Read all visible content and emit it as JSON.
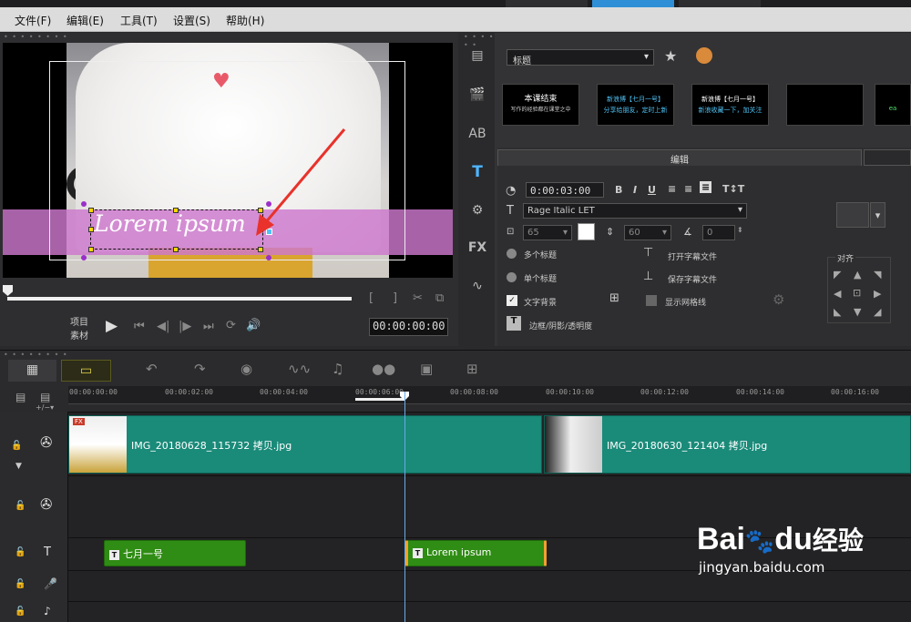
{
  "menu": [
    "文件(F)",
    "编辑(E)",
    "工具(T)",
    "设置(S)",
    "帮助(H)"
  ],
  "preview": {
    "title_text": "Lorem ipsum",
    "project_label": "项目",
    "clip_label": "素材",
    "timecode": "00:00:00:00"
  },
  "library": {
    "category": "标题",
    "thumbs": [
      {
        "line1": "本课结束",
        "line2": "写作的经验都在课堂之中"
      },
      {
        "line1": "新浪博【七月一号】",
        "line2": "分享给朋友，定时上新"
      },
      {
        "line1": "新浪博【七月一号】",
        "line2": "新浪收藏一下，加关注"
      },
      {
        "line1": "",
        "line2": ""
      },
      {
        "line1": "",
        "line2": "ea"
      }
    ]
  },
  "edit": {
    "tab_label": "编辑",
    "duration": "0:00:03:00",
    "font": "Rage Italic LET",
    "font_size": "65",
    "line_spacing": "60",
    "angle": "0",
    "multi_title": "多个标题",
    "single_title": "单个标题",
    "text_bg": "文字背景",
    "open_subtitle": "打开字幕文件",
    "save_subtitle": "保存字幕文件",
    "show_grid": "显示网格线",
    "border_shadow": "边框/阴影/透明度",
    "align_label": "对齐"
  },
  "timeline": {
    "ticks": [
      "00:00:00:00",
      "00:00:02:00",
      "00:00:04:00",
      "00:00:06:00",
      "00:00:08:00",
      "00:00:10:00",
      "00:00:12:00",
      "00:00:14:00",
      "00:00:16:00"
    ],
    "video_clips": [
      "IMG_20180628_115732 拷贝.jpg",
      "IMG_20180630_121404 拷贝.jpg"
    ],
    "title_clips": [
      "七月一号",
      "Lorem ipsum"
    ],
    "fx_badge": "FX"
  },
  "watermark": {
    "brand": "Bai",
    "brand2": "du",
    "cn": "经验",
    "url": "jingyan.baidu.com"
  },
  "colors": {
    "accent": "#2f8fd6",
    "video_clip": "#1a8a79",
    "title_clip": "#2f8c14"
  }
}
